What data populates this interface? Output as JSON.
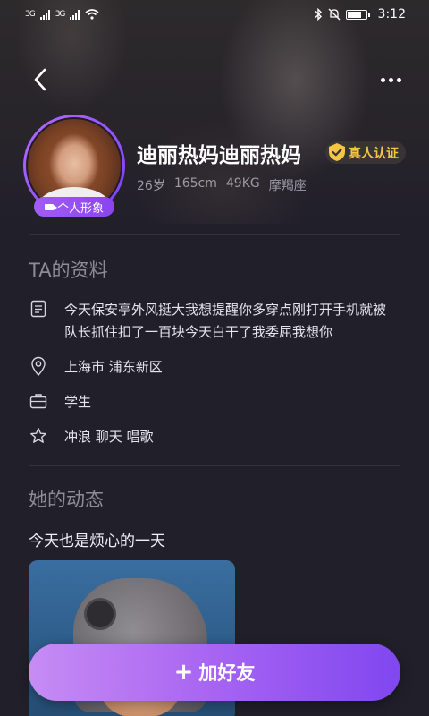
{
  "status_bar": {
    "signal1_label": "3G",
    "signal2_label": "3G",
    "time": "3:12"
  },
  "profile": {
    "name": "迪丽热妈迪丽热妈",
    "verified_label": "真人认证",
    "avatar_badge": "个人形象",
    "age": "26岁",
    "height": "165cm",
    "weight": "49KG",
    "zodiac": "摩羯座"
  },
  "about": {
    "title": "TA的资料",
    "bio": "今天保安亭外风挺大我想提醒你多穿点刚打开手机就被队长抓住扣了一百块今天白干了我委屈我想你",
    "location": "上海市 浦东新区",
    "occupation": "学生",
    "hobbies": "冲浪 聊天 唱歌"
  },
  "moments": {
    "title": "她的动态",
    "post_text": "今天也是烦心的一天"
  },
  "actions": {
    "add_friend_label": "加好友"
  },
  "colors": {
    "accent_start": "#c78cf4",
    "accent_end": "#8047f0",
    "verify_gold": "#f4c545",
    "background": "#211f2a"
  }
}
